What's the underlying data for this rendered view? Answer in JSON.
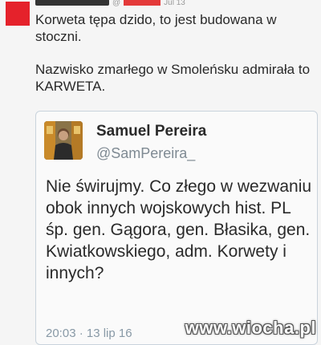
{
  "reply": {
    "header_handle_fragment": "@",
    "header_time": "Jul 13",
    "paragraph1": "Korweta tępa dzido, to jest budowana w stoczni.",
    "paragraph2": "Nazwisko zmarłego w Smoleńsku admirała to KARWETA."
  },
  "quoted_tweet": {
    "name": "Samuel Pereira",
    "handle": "@SamPereira_",
    "text": "Nie świrujmy. Co złego w wezwaniu obok innych wojskowych hist. PL śp. gen. Gągora, gen. Błasika, gen. Kwiatkowskiego, adm. Korwety i innych?",
    "timestamp": "20:03 · 13 lip 16"
  },
  "watermark": "www.wiocha.pl",
  "colors": {
    "background": "#f5f5f5",
    "redacted_avatar": "#e5222b",
    "card_border": "#c9d3dc",
    "muted_text": "#8899a6"
  }
}
